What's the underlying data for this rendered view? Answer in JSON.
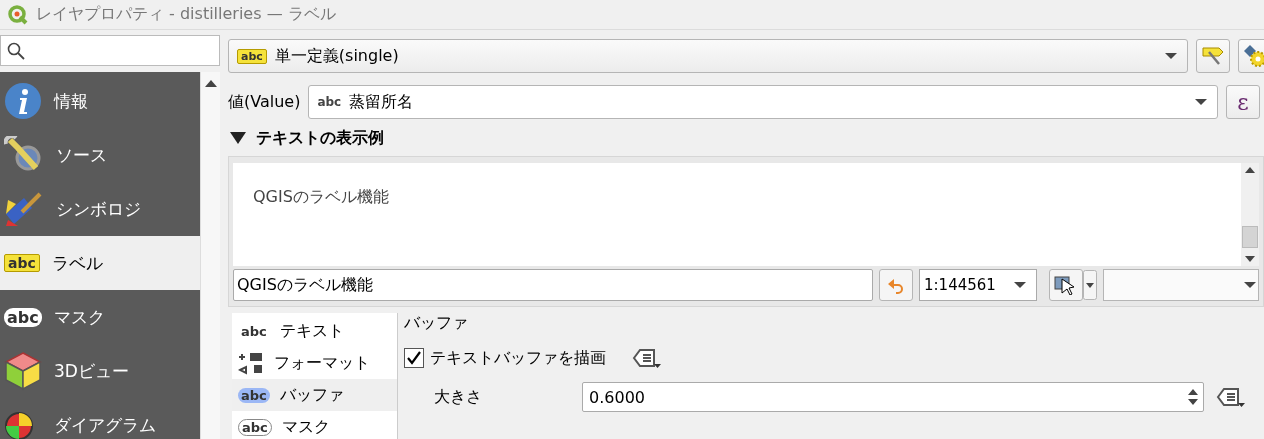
{
  "window": {
    "title": "レイヤプロパティ - distilleries — ラベル"
  },
  "sidebar": {
    "items": [
      {
        "kind": "info",
        "label": "情報",
        "selected": false
      },
      {
        "kind": "source",
        "label": "ソース",
        "selected": false
      },
      {
        "kind": "symbology",
        "label": "シンボロジ",
        "selected": false
      },
      {
        "kind": "label",
        "badge": "abc",
        "label": "ラベル",
        "selected": true
      },
      {
        "kind": "mask",
        "badge": "abc",
        "label": "マスク",
        "selected": false
      },
      {
        "kind": "cube",
        "label": "3Dビュー",
        "selected": false
      },
      {
        "kind": "diagram",
        "label": "ダイアグラム",
        "selected": false
      }
    ]
  },
  "mode": {
    "badge": "abc",
    "value": "単一定義(single)"
  },
  "value_row": {
    "label": "値(Value)",
    "badge": "abc",
    "value": "蒸留所名",
    "expression_button": "ε"
  },
  "preview": {
    "header": "テキストの表示例",
    "expanded": true,
    "sample": "QGISのラベル機能",
    "sample_input": "QGISのラベル機能",
    "scale": "1:144561"
  },
  "subtabs": [
    {
      "kind": "plain",
      "badge": "abc",
      "label": "テキスト",
      "selected": false
    },
    {
      "kind": "format",
      "label": "フォーマット",
      "selected": false
    },
    {
      "kind": "buffer",
      "badge": "abc",
      "label": "バッファ",
      "selected": true
    },
    {
      "kind": "outline",
      "badge": "abc",
      "label": "マスク",
      "selected": false
    }
  ],
  "buffer": {
    "title": "バッファ",
    "draw_label": "テキストバッファを描画",
    "draw_checked": true,
    "size_label": "大きさ",
    "size_value": "0.6000"
  }
}
